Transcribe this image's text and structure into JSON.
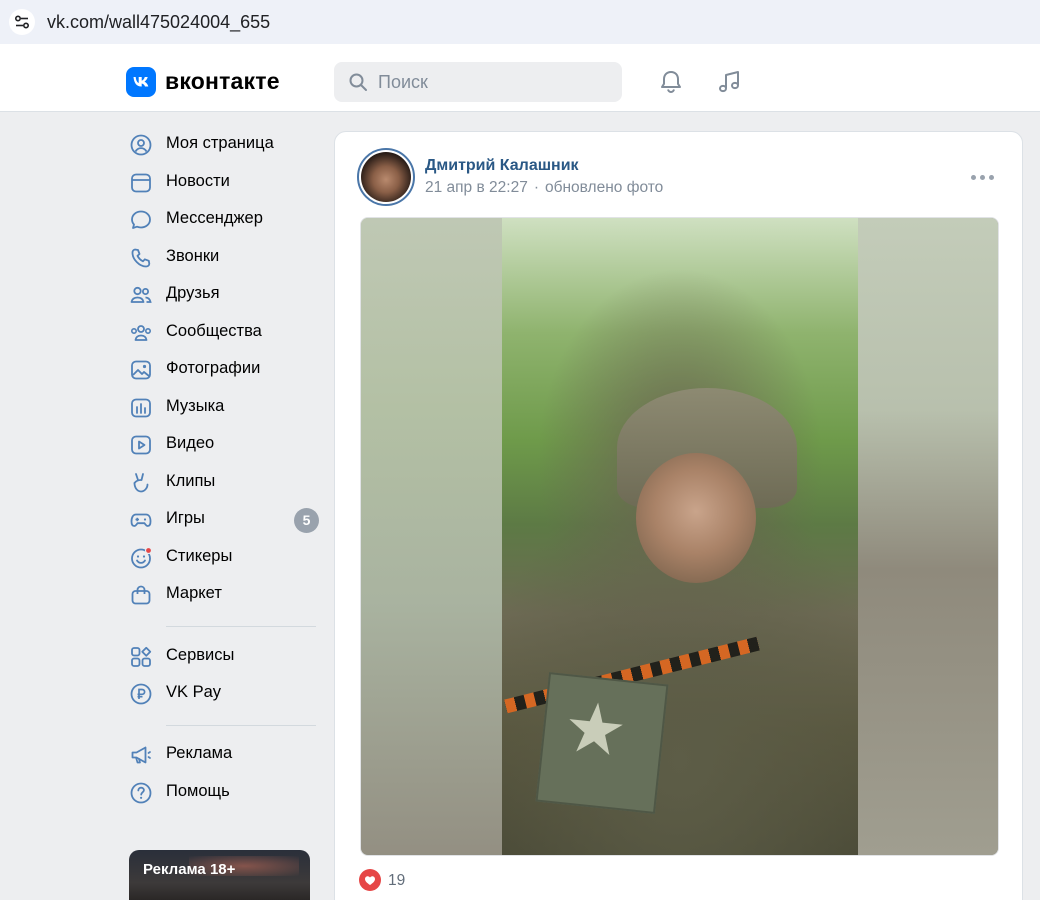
{
  "browser": {
    "url": "vk.com/wall475024004_655"
  },
  "header": {
    "logo_letter": "VK",
    "logo_text": "вконтакте",
    "search_placeholder": "Поиск",
    "icons": [
      "bell-icon",
      "music-icon"
    ]
  },
  "sidebar": {
    "items": [
      {
        "label": "Моя страница",
        "icon": "user-circle-icon"
      },
      {
        "label": "Новости",
        "icon": "newsfeed-icon"
      },
      {
        "label": "Мессенджер",
        "icon": "chat-bubble-icon"
      },
      {
        "label": "Звонки",
        "icon": "phone-icon"
      },
      {
        "label": "Друзья",
        "icon": "friends-icon"
      },
      {
        "label": "Сообщества",
        "icon": "communities-icon"
      },
      {
        "label": "Фотографии",
        "icon": "photo-icon"
      },
      {
        "label": "Музыка",
        "icon": "music-equalizer-icon"
      },
      {
        "label": "Видео",
        "icon": "video-icon"
      },
      {
        "label": "Клипы",
        "icon": "clips-icon"
      },
      {
        "label": "Игры",
        "icon": "gamepad-icon",
        "badge": "5"
      },
      {
        "label": "Стикеры",
        "icon": "smile-icon"
      },
      {
        "label": "Маркет",
        "icon": "shopping-bag-icon"
      },
      {
        "label": "Сервисы",
        "icon": "services-grid-icon"
      },
      {
        "label": "VK Pay",
        "icon": "ruble-icon"
      },
      {
        "label": "Реклама",
        "icon": "megaphone-icon"
      },
      {
        "label": "Помощь",
        "icon": "help-icon"
      }
    ],
    "ad_label": "Реклама 18+"
  },
  "post": {
    "author": "Дмитрий Калашник",
    "date": "21 апр в 22:27",
    "action": "обновлено фото",
    "likes": "19"
  },
  "colors": {
    "accent": "#0077ff",
    "link": "#2a5885",
    "muted": "#818c99",
    "like_red": "#e64646",
    "badge": "#99a2ad"
  }
}
